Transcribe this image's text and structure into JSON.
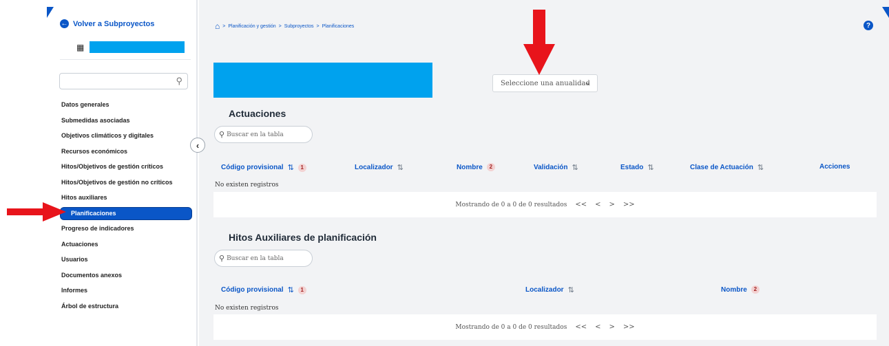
{
  "sidebar": {
    "back_label": "Volver a Subproyectos",
    "search_placeholder": "",
    "items": [
      {
        "label": "Datos generales"
      },
      {
        "label": "Submedidas asociadas"
      },
      {
        "label": "Objetivos climáticos y digitales"
      },
      {
        "label": "Recursos económicos"
      },
      {
        "label": "Hitos/Objetivos de gestión críticos"
      },
      {
        "label": "Hitos/Objetivos de gestión no críticos"
      },
      {
        "label": "Hitos auxiliares"
      },
      {
        "label": "Planificaciones",
        "active": true
      },
      {
        "label": "Progreso de indicadores"
      },
      {
        "label": "Actuaciones"
      },
      {
        "label": "Usuarios"
      },
      {
        "label": "Documentos anexos"
      },
      {
        "label": "Informes"
      },
      {
        "label": "Árbol de estructura"
      }
    ]
  },
  "breadcrumb": {
    "sep": ">",
    "items": [
      "Planificación y gestión",
      "Subproyectos",
      "Planificaciones"
    ]
  },
  "year_select": {
    "placeholder": "Seleccione una anualidad"
  },
  "actuaciones": {
    "title": "Actuaciones",
    "search_placeholder": "Buscar en la tabla",
    "columns": {
      "codigo": "Código provisional",
      "codigo_badge": "1",
      "localizador": "Localizador",
      "nombre": "Nombre",
      "nombre_badge": "2",
      "validacion": "Validación",
      "estado": "Estado",
      "clase": "Clase de Actuación",
      "acciones": "Acciones"
    },
    "empty": "No existen registros",
    "pagination": "Mostrando de 0 a 0 de 0 resultados"
  },
  "hitos": {
    "title": "Hitos Auxiliares de planificación",
    "search_placeholder": "Buscar en la tabla",
    "columns": {
      "codigo": "Código provisional",
      "codigo_badge": "1",
      "localizador": "Localizador",
      "nombre": "Nombre",
      "nombre_badge": "2"
    },
    "empty": "No existen registros",
    "pagination": "Mostrando de 0 a 0 de 0 resultados"
  },
  "pager": {
    "first": "<<",
    "prev": "<",
    "next": ">",
    "last": ">>"
  },
  "icons": {
    "back": "arrow-left-circle-icon",
    "project": "building-icon",
    "search": "search-icon",
    "collapse": "chevron-left-icon",
    "home": "home-icon",
    "help": "help-icon",
    "sort_asc": "sort-ascending-icon",
    "sort": "sort-icon"
  },
  "colors": {
    "primary": "#0a56c7",
    "placeholder_block": "#00a2ee",
    "annotation_arrow": "#e8141b"
  }
}
